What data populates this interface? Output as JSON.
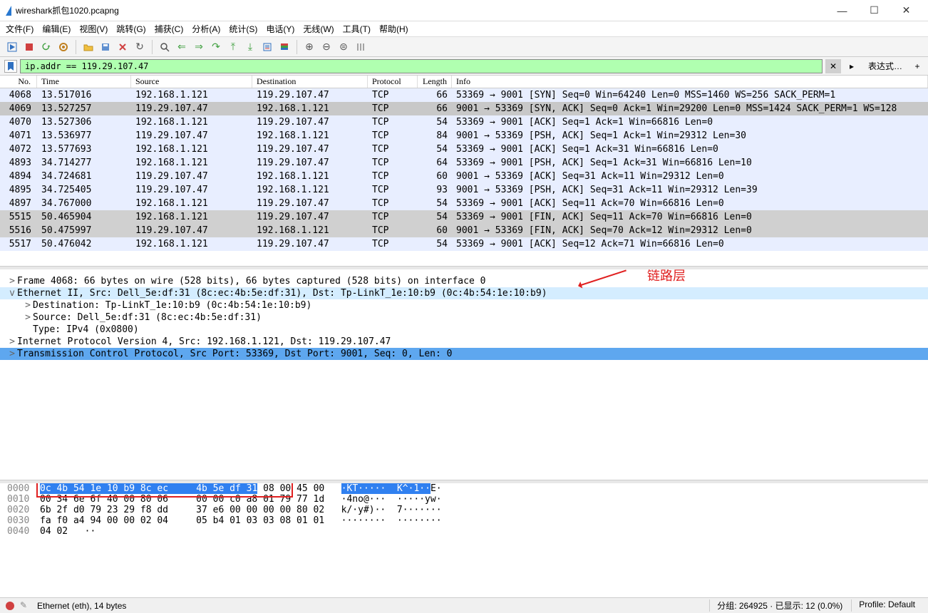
{
  "title": "wireshark抓包1020.pcapng",
  "winbtns": {
    "min": "—",
    "max": "☐",
    "close": "✕"
  },
  "menu": [
    "文件(F)",
    "编辑(E)",
    "视图(V)",
    "跳转(G)",
    "捕获(C)",
    "分析(A)",
    "统计(S)",
    "电话(Y)",
    "无线(W)",
    "工具(T)",
    "帮助(H)"
  ],
  "filter": {
    "value": "ip.addr == 119.29.107.47",
    "expr_label": "表达式…"
  },
  "columns": {
    "no": "No.",
    "time": "Time",
    "src": "Source",
    "dst": "Destination",
    "proto": "Protocol",
    "len": "Length",
    "info": "Info"
  },
  "packets": [
    {
      "no": "4068",
      "time": "13.517016",
      "src": "192.168.1.121",
      "dst": "119.29.107.47",
      "proto": "TCP",
      "len": "66",
      "info": "53369 → 9001 [SYN] Seq=0 Win=64240 Len=0 MSS=1460 WS=256 SACK_PERM=1",
      "cls": ""
    },
    {
      "no": "4069",
      "time": "13.527257",
      "src": "119.29.107.47",
      "dst": "192.168.1.121",
      "proto": "TCP",
      "len": "66",
      "info": "9001 → 53369 [SYN, ACK] Seq=0 Ack=1 Win=29200 Len=0 MSS=1424 SACK_PERM=1 WS=128",
      "cls": "gray"
    },
    {
      "no": "4070",
      "time": "13.527306",
      "src": "192.168.1.121",
      "dst": "119.29.107.47",
      "proto": "TCP",
      "len": "54",
      "info": "53369 → 9001 [ACK] Seq=1 Ack=1 Win=66816 Len=0",
      "cls": ""
    },
    {
      "no": "4071",
      "time": "13.536977",
      "src": "119.29.107.47",
      "dst": "192.168.1.121",
      "proto": "TCP",
      "len": "84",
      "info": "9001 → 53369 [PSH, ACK] Seq=1 Ack=1 Win=29312 Len=30",
      "cls": ""
    },
    {
      "no": "4072",
      "time": "13.577693",
      "src": "192.168.1.121",
      "dst": "119.29.107.47",
      "proto": "TCP",
      "len": "54",
      "info": "53369 → 9001 [ACK] Seq=1 Ack=31 Win=66816 Len=0",
      "cls": ""
    },
    {
      "no": "4893",
      "time": "34.714277",
      "src": "192.168.1.121",
      "dst": "119.29.107.47",
      "proto": "TCP",
      "len": "64",
      "info": "53369 → 9001 [PSH, ACK] Seq=1 Ack=31 Win=66816 Len=10",
      "cls": ""
    },
    {
      "no": "4894",
      "time": "34.724681",
      "src": "119.29.107.47",
      "dst": "192.168.1.121",
      "proto": "TCP",
      "len": "60",
      "info": "9001 → 53369 [ACK] Seq=31 Ack=11 Win=29312 Len=0",
      "cls": ""
    },
    {
      "no": "4895",
      "time": "34.725405",
      "src": "119.29.107.47",
      "dst": "192.168.1.121",
      "proto": "TCP",
      "len": "93",
      "info": "9001 → 53369 [PSH, ACK] Seq=31 Ack=11 Win=29312 Len=39",
      "cls": ""
    },
    {
      "no": "4897",
      "time": "34.767000",
      "src": "192.168.1.121",
      "dst": "119.29.107.47",
      "proto": "TCP",
      "len": "54",
      "info": "53369 → 9001 [ACK] Seq=11 Ack=70 Win=66816 Len=0",
      "cls": ""
    },
    {
      "no": "5515",
      "time": "50.465904",
      "src": "192.168.1.121",
      "dst": "119.29.107.47",
      "proto": "TCP",
      "len": "54",
      "info": "53369 → 9001 [FIN, ACK] Seq=11 Ack=70 Win=66816 Len=0",
      "cls": "sel"
    },
    {
      "no": "5516",
      "time": "50.475997",
      "src": "119.29.107.47",
      "dst": "192.168.1.121",
      "proto": "TCP",
      "len": "60",
      "info": "9001 → 53369 [FIN, ACK] Seq=70 Ack=12 Win=29312 Len=0",
      "cls": "sel"
    },
    {
      "no": "5517",
      "time": "50.476042",
      "src": "192.168.1.121",
      "dst": "119.29.107.47",
      "proto": "TCP",
      "len": "54",
      "info": "53369 → 9001 [ACK] Seq=12 Ack=71 Win=66816 Len=0",
      "cls": ""
    }
  ],
  "details": [
    {
      "ind": 0,
      "exp": ">",
      "text": "Frame 4068: 66 bytes on wire (528 bits), 66 bytes captured (528 bits) on interface 0",
      "cls": ""
    },
    {
      "ind": 0,
      "exp": "v",
      "text": "Ethernet II, Src: Dell_5e:df:31 (8c:ec:4b:5e:df:31), Dst: Tp-LinkT_1e:10:b9 (0c:4b:54:1e:10:b9)",
      "cls": "sel-light"
    },
    {
      "ind": 1,
      "exp": ">",
      "text": "Destination: Tp-LinkT_1e:10:b9 (0c:4b:54:1e:10:b9)",
      "cls": ""
    },
    {
      "ind": 1,
      "exp": ">",
      "text": "Source: Dell_5e:df:31 (8c:ec:4b:5e:df:31)",
      "cls": ""
    },
    {
      "ind": 1,
      "exp": " ",
      "text": "Type: IPv4 (0x0800)",
      "cls": ""
    },
    {
      "ind": 0,
      "exp": ">",
      "text": "Internet Protocol Version 4, Src: 192.168.1.121, Dst: 119.29.107.47",
      "cls": ""
    },
    {
      "ind": 0,
      "exp": ">",
      "text": "Transmission Control Protocol, Src Port: 53369, Dst Port: 9001, Seq: 0, Len: 0",
      "cls": "sel-blue"
    }
  ],
  "annotation_text": "链路层",
  "hex": [
    {
      "off": "0000",
      "b": "0c 4b 54 1e 10 b9 8c ec   4b 5e df 31 08 00 45 00",
      "a": "·KT·····  K^·1··E·",
      "hl": 14
    },
    {
      "off": "0010",
      "b": "00 34 6e 6f 40 00 80 06   00 00 c0 a8 01 79 77 1d",
      "a": "·4no@···  ·····yw·",
      "hl": 0
    },
    {
      "off": "0020",
      "b": "6b 2f d0 79 23 29 f8 dd   37 e6 00 00 00 00 80 02",
      "a": "k/·y#)··  7·······",
      "hl": 0
    },
    {
      "off": "0030",
      "b": "fa f0 a4 94 00 00 02 04   05 b4 01 03 03 08 01 01",
      "a": "········  ········",
      "hl": 0
    },
    {
      "off": "0040",
      "b": "04 02",
      "a": "··",
      "hl": 0
    }
  ],
  "status": {
    "left": "Ethernet (eth), 14 bytes",
    "mid": "分组: 264925 · 已显示: 12 (0.0%)",
    "right": "Profile: Default"
  }
}
